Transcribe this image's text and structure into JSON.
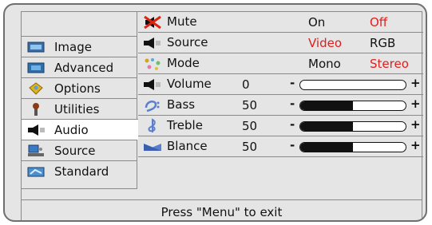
{
  "nav": {
    "items": [
      {
        "label": "Image",
        "icon": "image-icon"
      },
      {
        "label": "Advanced",
        "icon": "advanced-icon"
      },
      {
        "label": "Options",
        "icon": "options-icon"
      },
      {
        "label": "Utilities",
        "icon": "utilities-icon"
      },
      {
        "label": "Audio",
        "icon": "speaker-icon",
        "active": true
      },
      {
        "label": "Source",
        "icon": "source-icon"
      },
      {
        "label": "Standard",
        "icon": "standard-icon"
      }
    ]
  },
  "audio": {
    "mute": {
      "label": "Mute",
      "option_on": "On",
      "option_off": "Off",
      "selected": "Off"
    },
    "source": {
      "label": "Source",
      "option_video": "Video",
      "option_rgb": "RGB",
      "selected": "Video"
    },
    "mode": {
      "label": "Mode",
      "option_mono": "Mono",
      "option_stereo": "Stereo",
      "selected": "Stereo"
    },
    "volume": {
      "label": "Volume",
      "value": "0",
      "level": 0
    },
    "bass": {
      "label": "Bass",
      "value": "50",
      "level": 0.5
    },
    "treble": {
      "label": "Treble",
      "value": "50",
      "level": 0.5
    },
    "balance": {
      "label": "Blance",
      "value": "50",
      "level": 0.5
    },
    "minus_symbol": "-",
    "plus_symbol": "+"
  },
  "footer": {
    "text": "Press \"Menu\" to exit"
  },
  "colors": {
    "selected_option": "#e01e1e",
    "panel": "#e5e5e5"
  }
}
